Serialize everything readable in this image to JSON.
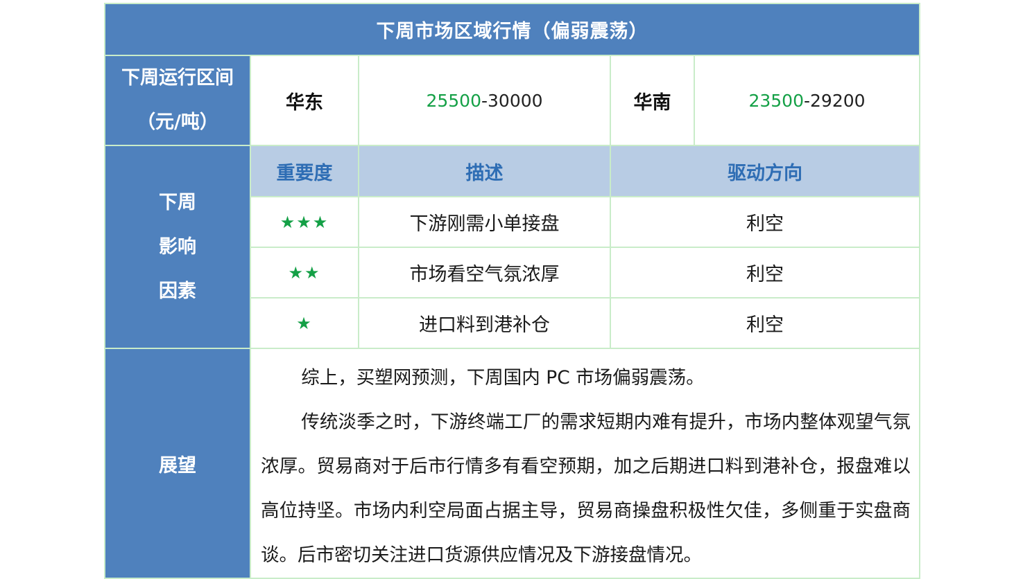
{
  "title": "下周市场区域行情（偏弱震荡）",
  "range": {
    "label_line1": "下周运行区间",
    "label_line2": "（元/吨）",
    "east": {
      "region": "华东",
      "low": "25500",
      "sep": "-",
      "high": "30000"
    },
    "south": {
      "region": "华南",
      "low": "23500",
      "sep": "-",
      "high": "29200"
    }
  },
  "factors": {
    "label_lines": [
      "下周",
      "影响",
      "因素"
    ],
    "headers": {
      "importance": "重要度",
      "description": "描述",
      "direction": "驱动方向"
    },
    "rows": [
      {
        "stars": "★★★",
        "description": "下游刚需小单接盘",
        "direction": "利空"
      },
      {
        "stars": "★★",
        "description": "市场看空气氛浓厚",
        "direction": "利空"
      },
      {
        "stars": "★",
        "description": "进口料到港补仓",
        "direction": "利空"
      }
    ]
  },
  "outlook": {
    "label": "展望",
    "paragraphs": [
      "综上，买塑网预测，下周国内 PC 市场偏弱震荡。",
      "传统淡季之时，下游终端工厂的需求短期内难有提升，市场内整体观望气氛浓厚。贸易商对于后市行情多有看空预期，加之后期进口料到港补仓，报盘难以高位持坚。市场内利空局面占据主导，贸易商操盘积极性欠佳，多侧重于实盘商谈。后市密切关注进口货源供应情况及下游接盘情况。"
    ]
  },
  "colors": {
    "header_blue": "#4f81bd",
    "subheader_blue": "#b8cce4",
    "green_accent": "#14a046",
    "border_green": "#c9ecc9"
  }
}
